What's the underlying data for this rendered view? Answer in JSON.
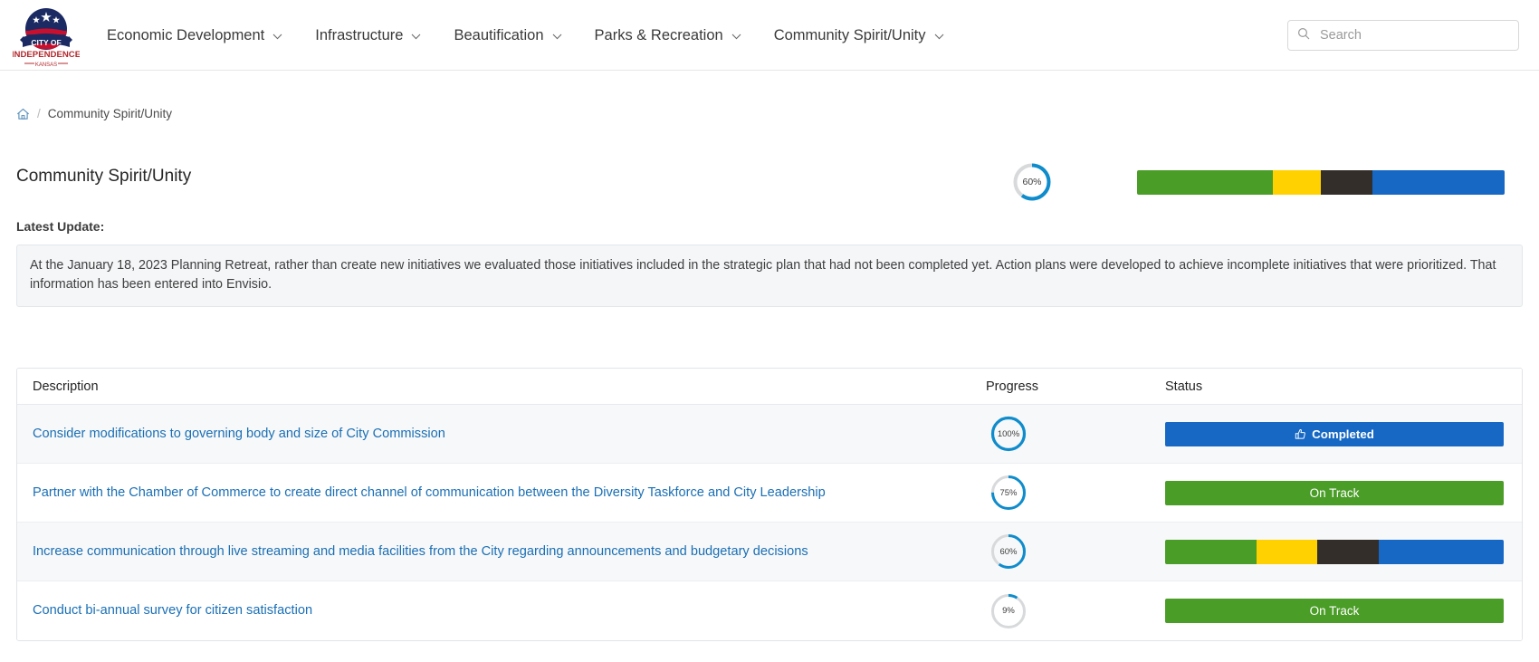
{
  "header": {
    "logo": {
      "name": "city-of-independence-kansas-seal",
      "line1": "CITY OF",
      "line2": "INDEPENDENCE",
      "line3": "KANSAS"
    },
    "nav": [
      {
        "label": "Economic Development",
        "icon": "chevron-down-icon"
      },
      {
        "label": "Infrastructure",
        "icon": "chevron-down-icon"
      },
      {
        "label": "Beautification",
        "icon": "chevron-down-icon"
      },
      {
        "label": "Parks & Recreation",
        "icon": "chevron-down-icon"
      },
      {
        "label": "Community Spirit/Unity",
        "icon": "chevron-down-icon"
      }
    ],
    "search": {
      "placeholder": "Search",
      "value": "",
      "icon": "search-icon"
    }
  },
  "breadcrumb": {
    "home_icon": "home-icon",
    "separator": "/",
    "current": "Community Spirit/Unity"
  },
  "page": {
    "title": "Community Spirit/Unity",
    "overall_progress_pct": 60,
    "overall_progress_label": "60%",
    "status_segments": [
      {
        "name": "on-track",
        "color": "#4a9d27",
        "width_pct": 37
      },
      {
        "name": "caution",
        "color": "#ffd100",
        "width_pct": 13
      },
      {
        "name": "off-track",
        "color": "#332e2a",
        "width_pct": 14
      },
      {
        "name": "completed",
        "color": "#1668c4",
        "width_pct": 36
      }
    ]
  },
  "latest_update": {
    "label": "Latest Update:",
    "text": "At the January 18, 2023 Planning Retreat, rather than create new initiatives we evaluated those initiatives included in the strategic plan that had not been completed yet. Action plans were developed to achieve incomplete initiatives that were prioritized. That information has been entered into Envisio."
  },
  "table": {
    "columns": [
      "Description",
      "Progress",
      "Status"
    ],
    "rows": [
      {
        "description": "Consider modifications to governing body and size of City Commission",
        "progress_pct": 100,
        "progress_label": "100%",
        "status_type": "completed",
        "status_label": "Completed",
        "status_icon": "thumbs-up-icon",
        "status_color": "#1668c4",
        "segments": [
          {
            "name": "completed",
            "color": "#1668c4",
            "width_pct": 100
          }
        ]
      },
      {
        "description": "Partner with the Chamber of Commerce to create direct channel of communication between the Diversity Taskforce and City Leadership",
        "progress_pct": 75,
        "progress_label": "75%",
        "status_type": "on-track",
        "status_label": "On Track",
        "status_icon": "",
        "status_color": "#4a9d27",
        "segments": [
          {
            "name": "on-track",
            "color": "#4a9d27",
            "width_pct": 100
          }
        ]
      },
      {
        "description": "Increase communication through live streaming and media facilities from the City regarding announcements and budgetary decisions",
        "progress_pct": 60,
        "progress_label": "60%",
        "status_type": "mixed",
        "status_label": "",
        "status_icon": "",
        "status_color": "",
        "segments": [
          {
            "name": "on-track",
            "color": "#4a9d27",
            "width_pct": 27
          },
          {
            "name": "caution",
            "color": "#ffd100",
            "width_pct": 18
          },
          {
            "name": "off-track",
            "color": "#332e2a",
            "width_pct": 18
          },
          {
            "name": "completed",
            "color": "#1668c4",
            "width_pct": 37
          }
        ]
      },
      {
        "description": "Conduct bi-annual survey for citizen satisfaction",
        "progress_pct": 9,
        "progress_label": "9%",
        "status_type": "on-track",
        "status_label": "On Track",
        "status_icon": "",
        "status_color": "#4a9d27",
        "segments": [
          {
            "name": "on-track",
            "color": "#4a9d27",
            "width_pct": 100
          }
        ]
      }
    ]
  },
  "colors": {
    "link": "#1a6fb5",
    "donut_fill": "#0e8ccc",
    "donut_track": "#d7d9db",
    "green": "#4a9d27",
    "yellow": "#ffd100",
    "dark": "#332e2a",
    "blue": "#1668c4"
  }
}
